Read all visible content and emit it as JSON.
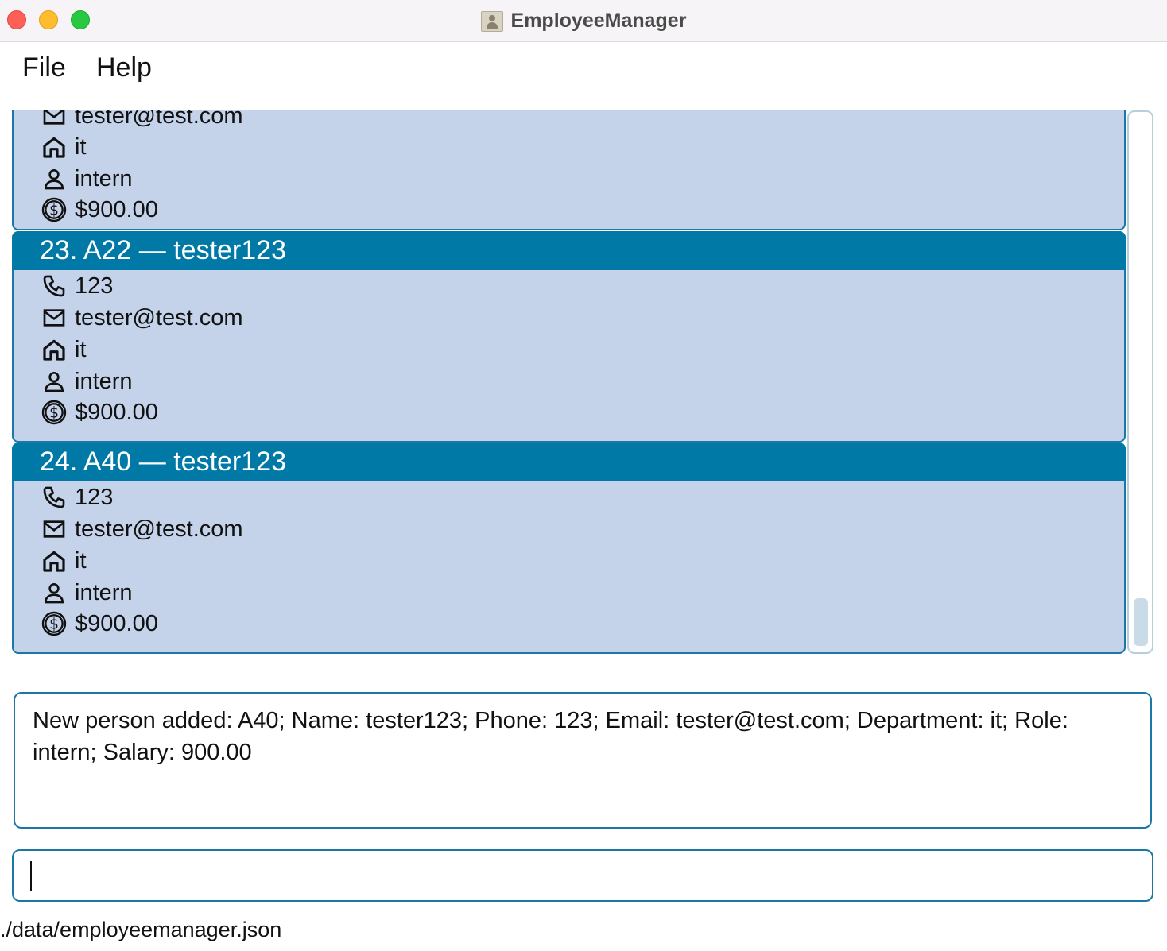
{
  "window": {
    "title": "EmployeeManager"
  },
  "menu": {
    "file_label": "File",
    "help_label": "Help"
  },
  "employees": [
    {
      "header": "",
      "phone": "",
      "email": "tester@test.com",
      "department": "it",
      "role": "intern",
      "salary": "$900.00"
    },
    {
      "header": "23.  A22 — tester123",
      "phone": "123",
      "email": "tester@test.com",
      "department": "it",
      "role": "intern",
      "salary": "$900.00"
    },
    {
      "header": "24.  A40 — tester123",
      "phone": "123",
      "email": "tester@test.com",
      "department": "it",
      "role": "intern",
      "salary": "$900.00"
    }
  ],
  "result": {
    "text": "New person added: A40; Name: tester123; Phone: 123; Email: tester@test.com; Department: it; Role: intern; Salary: 900.00"
  },
  "command": {
    "value": ""
  },
  "status": {
    "path": "./data/employeemanager.json"
  },
  "colors": {
    "header": "#0079a6",
    "card": "#c5d3ea",
    "border": "#1b78a6"
  }
}
